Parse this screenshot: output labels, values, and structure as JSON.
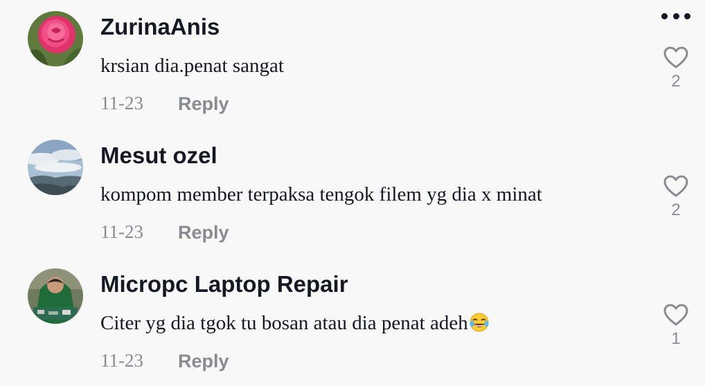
{
  "menu": {
    "icon": "more-horizontal-icon"
  },
  "comments": [
    {
      "username": "ZurinaAnis",
      "text": "krsian dia.penat sangat",
      "date": "11-23",
      "reply_label": "Reply",
      "likes": "2",
      "avatar": "pink-rose"
    },
    {
      "username": "Mesut ozel",
      "text": "kompom member terpaksa tengok filem yg dia x minat",
      "date": "11-23",
      "reply_label": "Reply",
      "likes": "2",
      "avatar": "cloudy-sky"
    },
    {
      "username": "Micropc Laptop Repair",
      "text": "Citer yg dia tgok tu bosan atau dia penat adeh",
      "emoji": "😂",
      "date": "11-23",
      "reply_label": "Reply",
      "likes": "1",
      "avatar": "technician-photo"
    }
  ],
  "icons": {
    "like": "heart-outline-icon",
    "emoji": "face-with-tears-of-joy-icon"
  },
  "colors": {
    "background": "#f8f8f8",
    "primary_text": "#161823",
    "secondary_text": "#8a8b91"
  }
}
